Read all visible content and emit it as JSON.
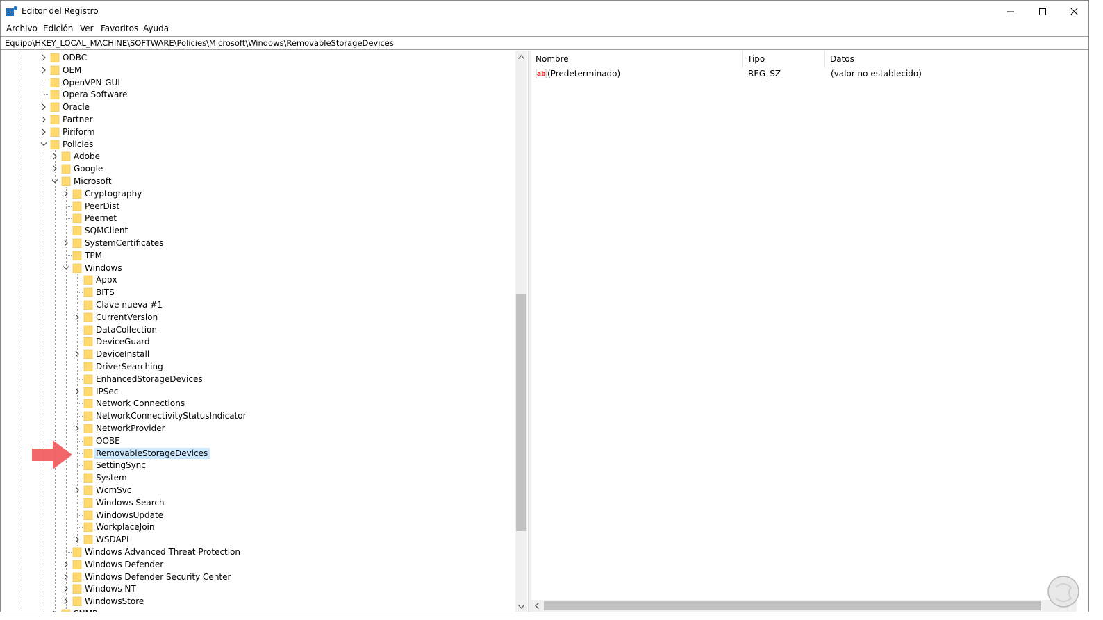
{
  "window": {
    "title": "Editor del Registro"
  },
  "menu": [
    "Archivo",
    "Edición",
    "Ver",
    "Favoritos",
    "Ayuda"
  ],
  "address": "Equipo\\HKEY_LOCAL_MACHINE\\SOFTWARE\\Policies\\Microsoft\\Windows\\RemovableStorageDevices",
  "tree": [
    {
      "label": "ODBC",
      "level": 0,
      "expander": "closed"
    },
    {
      "label": "OEM",
      "level": 0,
      "expander": "closed"
    },
    {
      "label": "OpenVPN-GUI",
      "level": 0,
      "expander": "none"
    },
    {
      "label": "Opera Software",
      "level": 0,
      "expander": "none"
    },
    {
      "label": "Oracle",
      "level": 0,
      "expander": "closed"
    },
    {
      "label": "Partner",
      "level": 0,
      "expander": "closed"
    },
    {
      "label": "Piriform",
      "level": 0,
      "expander": "closed"
    },
    {
      "label": "Policies",
      "level": 0,
      "expander": "open"
    },
    {
      "label": "Adobe",
      "level": 1,
      "expander": "closed"
    },
    {
      "label": "Google",
      "level": 1,
      "expander": "closed"
    },
    {
      "label": "Microsoft",
      "level": 1,
      "expander": "open"
    },
    {
      "label": "Cryptography",
      "level": 2,
      "expander": "closed"
    },
    {
      "label": "PeerDist",
      "level": 2,
      "expander": "none"
    },
    {
      "label": "Peernet",
      "level": 2,
      "expander": "none"
    },
    {
      "label": "SQMClient",
      "level": 2,
      "expander": "none"
    },
    {
      "label": "SystemCertificates",
      "level": 2,
      "expander": "closed"
    },
    {
      "label": "TPM",
      "level": 2,
      "expander": "none"
    },
    {
      "label": "Windows",
      "level": 2,
      "expander": "open"
    },
    {
      "label": "Appx",
      "level": 3,
      "expander": "none"
    },
    {
      "label": "BITS",
      "level": 3,
      "expander": "none"
    },
    {
      "label": "Clave nueva #1",
      "level": 3,
      "expander": "none"
    },
    {
      "label": "CurrentVersion",
      "level": 3,
      "expander": "closed"
    },
    {
      "label": "DataCollection",
      "level": 3,
      "expander": "none"
    },
    {
      "label": "DeviceGuard",
      "level": 3,
      "expander": "none"
    },
    {
      "label": "DeviceInstall",
      "level": 3,
      "expander": "closed"
    },
    {
      "label": "DriverSearching",
      "level": 3,
      "expander": "none"
    },
    {
      "label": "EnhancedStorageDevices",
      "level": 3,
      "expander": "none"
    },
    {
      "label": "IPSec",
      "level": 3,
      "expander": "closed"
    },
    {
      "label": "Network Connections",
      "level": 3,
      "expander": "none"
    },
    {
      "label": "NetworkConnectivityStatusIndicator",
      "level": 3,
      "expander": "none"
    },
    {
      "label": "NetworkProvider",
      "level": 3,
      "expander": "closed"
    },
    {
      "label": "OOBE",
      "level": 3,
      "expander": "none"
    },
    {
      "label": "RemovableStorageDevices",
      "level": 3,
      "expander": "none",
      "selected": true
    },
    {
      "label": "SettingSync",
      "level": 3,
      "expander": "none"
    },
    {
      "label": "System",
      "level": 3,
      "expander": "none"
    },
    {
      "label": "WcmSvc",
      "level": 3,
      "expander": "closed"
    },
    {
      "label": "Windows Search",
      "level": 3,
      "expander": "none"
    },
    {
      "label": "WindowsUpdate",
      "level": 3,
      "expander": "none"
    },
    {
      "label": "WorkplaceJoin",
      "level": 3,
      "expander": "none"
    },
    {
      "label": "WSDAPI",
      "level": 3,
      "expander": "closed"
    },
    {
      "label": "Windows Advanced Threat Protection",
      "level": 2,
      "expander": "none"
    },
    {
      "label": "Windows Defender",
      "level": 2,
      "expander": "closed"
    },
    {
      "label": "Windows Defender Security Center",
      "level": 2,
      "expander": "closed"
    },
    {
      "label": "Windows NT",
      "level": 2,
      "expander": "closed"
    },
    {
      "label": "WindowsStore",
      "level": 2,
      "expander": "closed"
    },
    {
      "label": "SNMP",
      "level": 1,
      "expander": "closed"
    }
  ],
  "list": {
    "columns": [
      "Nombre",
      "Tipo",
      "Datos"
    ],
    "rows": [
      {
        "name": "(Predeterminado)",
        "type": "REG_SZ",
        "data": "(valor no establecido)",
        "icon": "reg-sz-icon"
      }
    ]
  },
  "colors": {
    "folder": "#ffd86e",
    "selection": "#cce8ff",
    "pointer": "#f0565a",
    "accent": "#0078d7"
  }
}
